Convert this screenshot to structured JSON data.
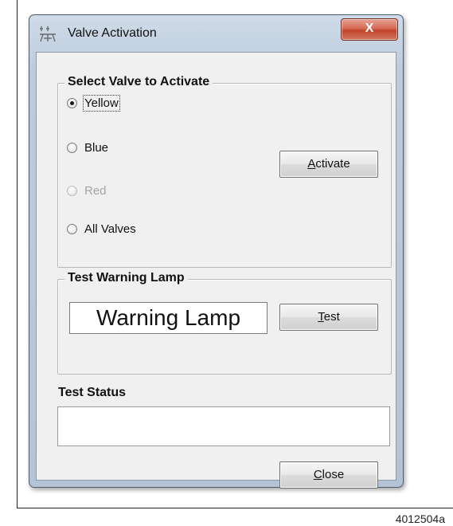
{
  "figure_code": "4012504a",
  "window": {
    "title": "Valve Activation",
    "close_label": "X",
    "app_icon": "valve-icon"
  },
  "valve_group": {
    "title": "Select Valve to Activate",
    "options": [
      {
        "label": "Yellow",
        "selected": true,
        "enabled": true
      },
      {
        "label": "Blue",
        "selected": false,
        "enabled": true
      },
      {
        "label": "Red",
        "selected": false,
        "enabled": false
      },
      {
        "label": "All Valves",
        "selected": false,
        "enabled": true
      }
    ],
    "activate_accel": "A",
    "activate_rest": "ctivate"
  },
  "lamp_group": {
    "title": "Test Warning Lamp",
    "lamp_text": "Warning Lamp",
    "test_accel": "T",
    "test_rest": "est"
  },
  "status": {
    "label": "Test Status",
    "value": ""
  },
  "close_button": {
    "accel": "C",
    "rest": "lose"
  }
}
